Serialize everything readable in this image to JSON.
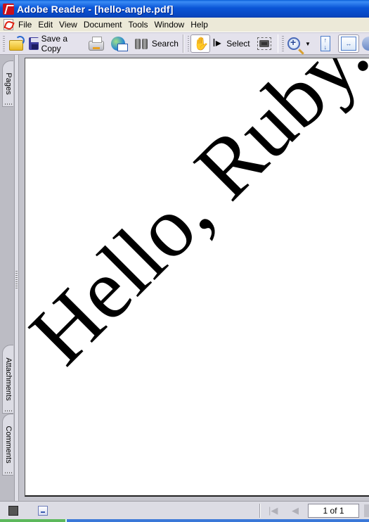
{
  "window": {
    "app_title": "Adobe Reader - [hello-angle.pdf]"
  },
  "menu": {
    "items": [
      {
        "label": "File"
      },
      {
        "label": "Edit"
      },
      {
        "label": "View"
      },
      {
        "label": "Document"
      },
      {
        "label": "Tools"
      },
      {
        "label": "Window"
      },
      {
        "label": "Help"
      }
    ]
  },
  "toolbar": {
    "open_icon": "folder-open-icon",
    "save_copy_label": "Save a Copy",
    "print_icon": "printer-icon",
    "email_icon": "email-globe-icon",
    "search_label": "Search",
    "hand_tool_icon": "hand-icon",
    "select_label": "Select",
    "snapshot_icon": "camera-icon",
    "zoom_icon": "zoom-in-icon",
    "fit_page_icon": "fit-page-icon",
    "fit_width_icon": "fit-width-icon"
  },
  "nav_panel": {
    "tabs": [
      {
        "label": "Pages"
      },
      {
        "label": "Attachments"
      },
      {
        "label": "Comments"
      }
    ]
  },
  "document": {
    "text": "Hello, Ruby.",
    "rotation_degrees": 45,
    "text_color": "#000000"
  },
  "statusbar": {
    "page_indicator": "1 of 1",
    "first_page_icon": "first-page-icon",
    "prev_page_icon": "previous-page-icon"
  },
  "colors": {
    "titlebar": "#0a55d6",
    "chrome": "#e4e2ec",
    "doc_background": "#c4c4cc"
  }
}
